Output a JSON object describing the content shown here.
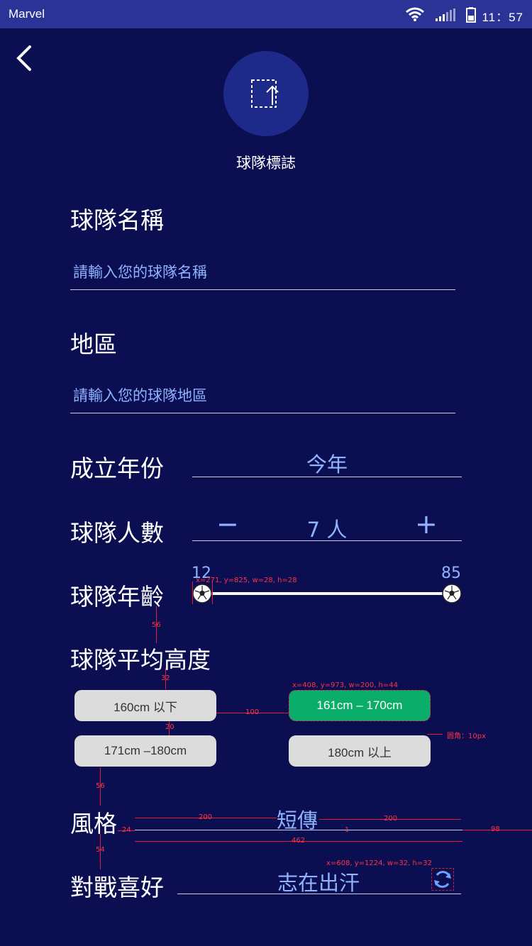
{
  "status": {
    "carrier": "Marvel",
    "time": "11：57"
  },
  "header": {
    "logo_label": "球隊標誌"
  },
  "form": {
    "team_name_label": "球隊名稱",
    "team_name_placeholder": "請輸入您的球隊名稱",
    "region_label": "地區",
    "region_placeholder": "請輸入您的球隊地區",
    "founded_label": "成立年份",
    "founded_value": "今年",
    "members_label": "球隊人數",
    "members_value": "7 人",
    "minus_symbol": "−",
    "plus_symbol": "+",
    "age_label": "球隊年齡",
    "age_min": "12",
    "age_max": "85",
    "height_label": "球隊平均高度",
    "height_options": [
      "160cm 以下",
      "161cm – 170cm",
      "171cm –180cm",
      "180cm 以上"
    ],
    "height_selected_index": 1,
    "style_label": "風格",
    "style_value": "短傳",
    "preference_label": "對戰喜好",
    "preference_value": "志在出汗"
  },
  "annotations": {
    "ball": "x=271, y=825, w=28, h=28",
    "gap56a": "56",
    "gap32": "32",
    "pill_box": "x=408, y=973, w=200, h=44",
    "gap100": "100",
    "gap20": "20",
    "radius": "圆角：10px",
    "gap56b": "56",
    "w200a": "200",
    "w200b": "200",
    "w24": "24",
    "w1": "1",
    "w98": "98",
    "w462": "462",
    "gap54": "54",
    "refresh_box": "x=608, y=1224, w=32, h=32"
  },
  "icons": {
    "back": "chevron-left-icon",
    "upload": "upload-icon",
    "ball": "soccer-ball-icon",
    "refresh": "refresh-icon"
  }
}
